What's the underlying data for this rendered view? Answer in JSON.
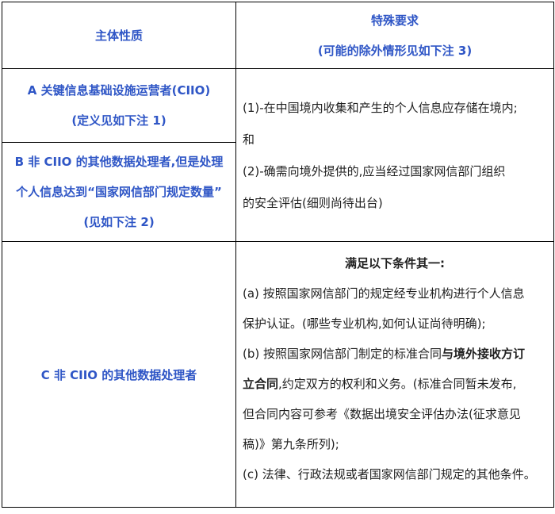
{
  "header": {
    "col1": "主体性质",
    "col2_line1": "特殊要求",
    "col2_line2": "(可能的除外情形见如下注 3)"
  },
  "row_a": {
    "line1": "A 关键信息基础设施运营者(CIIO)",
    "line2": "(定义见如下注 1)"
  },
  "row_b": {
    "line1": "B 非 CIIO 的其他数据处理者,但是处理",
    "line2": "个人信息达到“国家网信部门规定数量”",
    "line3": "(见如下注 2)"
  },
  "ab_requirements": {
    "line1": "(1)-在中国境内收集和产生的个人信息应存储在境内;",
    "line2": "和",
    "line3": "(2)-确需向境外提供的,应当经过国家网信部门组织",
    "line4": "的安全评估(细则尚待出台)"
  },
  "row_c": {
    "label": "C 非 CIIO 的其他数据处理者"
  },
  "c_requirements": {
    "title": "满足以下条件其一:",
    "a_line1": "(a) 按照国家网信部门的规定经专业机构进行个人信息",
    "a_line2": "保护认证。(哪些专业机构,如何认证尚待明确);",
    "b_line1_pre": "(b) 按照国家网信部门制定的标准合同",
    "b_line1_bold": "与境外接收方订",
    "b_line2_bold": "立合同",
    "b_line2_post": ",约定双方的权利和义务。(标准合同暂未发布,",
    "b_line3": "但合同内容可参考《数据出境安全评估办法(征求意见",
    "b_line4": "稿)》第九条所列);",
    "c_line1": "(c) 法律、行政法规或者国家网信部门规定的其他条件。"
  }
}
